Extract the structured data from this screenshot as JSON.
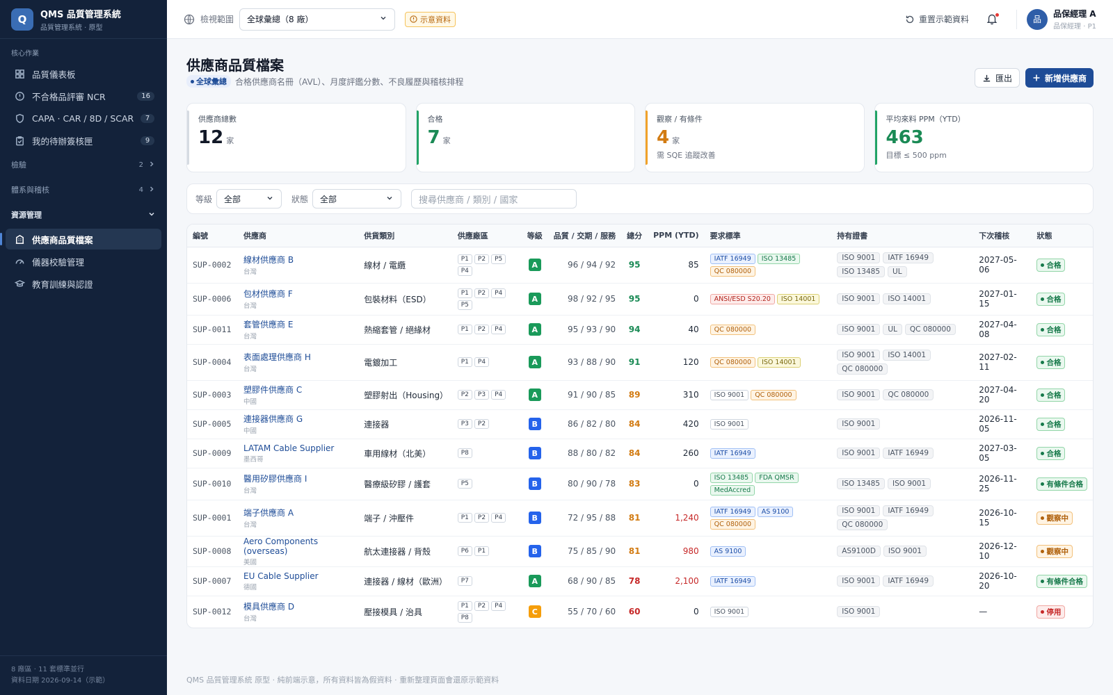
{
  "app": {
    "title": "QMS 品質管理系統",
    "subtitle": "品質管理系統 · 原型",
    "logo_letter": "Q"
  },
  "sidebar": {
    "core_section": "核心作業",
    "core_items": [
      {
        "label": "品質儀表板",
        "icon": "dashboard-icon",
        "badge": ""
      },
      {
        "label": "不合格品評審 NCR",
        "icon": "alert-circle-icon",
        "badge": "16"
      },
      {
        "label": "CAPA · CAR / 8D / SCAR",
        "icon": "shield-icon",
        "badge": "7"
      },
      {
        "label": "我的待辦簽核匣",
        "icon": "clipboard-icon",
        "badge": "9"
      }
    ],
    "groups": [
      {
        "label": "檢驗",
        "count": "2"
      },
      {
        "label": "體系與稽核",
        "count": "4"
      }
    ],
    "resource_section": "資源管理",
    "resource_items": [
      {
        "label": "供應商品質檔案",
        "icon": "building-icon",
        "active": true
      },
      {
        "label": "儀器校驗管理",
        "icon": "gauge-icon",
        "active": false
      },
      {
        "label": "教育訓練與認證",
        "icon": "graduation-cap-icon",
        "active": false
      }
    ],
    "footer_line1": "8 廠區 · 11 套標準並行",
    "footer_line2": "資料日期 2026-09-14（示範）"
  },
  "topbar": {
    "scope_label": "檢視範圍",
    "scope_value": "全球彙總（8 廠）",
    "demo_badge": "示意資料",
    "reset_label": "重置示範資料",
    "user_name": "品保經理 A",
    "user_role": "品保經理 · P1",
    "avatar_text": "品"
  },
  "page": {
    "title": "供應商品質檔案",
    "scope_chip": "全球彙總",
    "subtitle": "合格供應商名冊（AVL）、月度評鑑分數、不良履歷與稽核排程",
    "export_label": "匯出",
    "add_label": "新增供應商"
  },
  "kpis": [
    {
      "label": "供應商總數",
      "value": "12",
      "unit": "家",
      "note": ""
    },
    {
      "label": "合格",
      "value": "7",
      "unit": "家",
      "note": ""
    },
    {
      "label": "觀察 / 有條件",
      "value": "4",
      "unit": "家",
      "note": "需 SQE 追蹤改善"
    },
    {
      "label": "平均來料 PPM（YTD）",
      "value": "463",
      "unit": "",
      "note": "目標 ≤ 500 ppm"
    }
  ],
  "filters": {
    "grade_label": "等級",
    "grade_value": "全部",
    "status_label": "狀態",
    "status_value": "全部",
    "search_placeholder": "搜尋供應商 / 類別 / 國家"
  },
  "table": {
    "headers": [
      "編號",
      "供應商",
      "供貨類別",
      "供應廠區",
      "等級",
      "品質 / 交期 / 服務",
      "總分",
      "PPM (YTD)",
      "要求標準",
      "持有證書",
      "下次稽核",
      "狀態"
    ],
    "rows": [
      {
        "code": "SUP-0002",
        "name": "線材供應商 B",
        "country": "台灣",
        "category": "線材 / 電纜",
        "plants": [
          "P1",
          "P2",
          "P5",
          "P4"
        ],
        "grade": "A",
        "scores": "96 / 94 / 92",
        "total": "95",
        "total_level": "hi",
        "ppm": "85",
        "ppm_bad": false,
        "standards": [
          {
            "t": "IATF 16949",
            "c": "blue"
          },
          {
            "t": "ISO 13485",
            "c": "green"
          },
          {
            "t": "QC 080000",
            "c": "orange"
          }
        ],
        "certs": [
          "ISO 9001",
          "IATF 16949",
          "ISO 13485",
          "UL"
        ],
        "next_audit": "2027-05-06",
        "status": "合格",
        "status_type": "ok"
      },
      {
        "code": "SUP-0006",
        "name": "包材供應商 F",
        "country": "台灣",
        "category": "包裝材料（ESD）",
        "plants": [
          "P1",
          "P2",
          "P4",
          "P5"
        ],
        "grade": "A",
        "scores": "98 / 92 / 95",
        "total": "95",
        "total_level": "hi",
        "ppm": "0",
        "ppm_bad": false,
        "standards": [
          {
            "t": "ANSI/ESD S20.20",
            "c": "red"
          },
          {
            "t": "ISO 14001",
            "c": "yellow"
          }
        ],
        "certs": [
          "ISO 9001",
          "ISO 14001"
        ],
        "next_audit": "2027-01-15",
        "status": "合格",
        "status_type": "ok"
      },
      {
        "code": "SUP-0011",
        "name": "套管供應商 E",
        "country": "台灣",
        "category": "熱縮套管 / 絕緣材",
        "plants": [
          "P1",
          "P2",
          "P4"
        ],
        "grade": "A",
        "scores": "95 / 93 / 90",
        "total": "94",
        "total_level": "hi",
        "ppm": "40",
        "ppm_bad": false,
        "standards": [
          {
            "t": "QC 080000",
            "c": "orange"
          }
        ],
        "certs": [
          "ISO 9001",
          "UL",
          "QC 080000"
        ],
        "next_audit": "2027-04-08",
        "status": "合格",
        "status_type": "ok"
      },
      {
        "code": "SUP-0004",
        "name": "表面處理供應商 H",
        "country": "台灣",
        "category": "電鍍加工",
        "plants": [
          "P1",
          "P4"
        ],
        "grade": "A",
        "scores": "93 / 88 / 90",
        "total": "91",
        "total_level": "hi",
        "ppm": "120",
        "ppm_bad": false,
        "standards": [
          {
            "t": "QC 080000",
            "c": "orange"
          },
          {
            "t": "ISO 14001",
            "c": "yellow"
          }
        ],
        "certs": [
          "ISO 9001",
          "ISO 14001",
          "QC 080000"
        ],
        "next_audit": "2027-02-11",
        "status": "合格",
        "status_type": "ok"
      },
      {
        "code": "SUP-0003",
        "name": "塑膠件供應商 C",
        "country": "中國",
        "category": "塑膠射出（Housing）",
        "plants": [
          "P2",
          "P3",
          "P4"
        ],
        "grade": "A",
        "scores": "91 / 90 / 85",
        "total": "89",
        "total_level": "mid",
        "ppm": "310",
        "ppm_bad": false,
        "standards": [
          {
            "t": "ISO 9001",
            "c": "gray"
          },
          {
            "t": "QC 080000",
            "c": "orange"
          }
        ],
        "certs": [
          "ISO 9001",
          "QC 080000"
        ],
        "next_audit": "2027-04-20",
        "status": "合格",
        "status_type": "ok"
      },
      {
        "code": "SUP-0005",
        "name": "連接器供應商 G",
        "country": "中國",
        "category": "連接器",
        "plants": [
          "P3",
          "P2"
        ],
        "grade": "B",
        "scores": "86 / 82 / 80",
        "total": "84",
        "total_level": "mid",
        "ppm": "420",
        "ppm_bad": false,
        "standards": [
          {
            "t": "ISO 9001",
            "c": "gray"
          }
        ],
        "certs": [
          "ISO 9001"
        ],
        "next_audit": "2026-11-05",
        "status": "合格",
        "status_type": "ok"
      },
      {
        "code": "SUP-0009",
        "name": "LATAM Cable Supplier",
        "country": "墨西哥",
        "category": "車用線材（北美）",
        "plants": [
          "P8"
        ],
        "grade": "B",
        "scores": "88 / 80 / 82",
        "total": "84",
        "total_level": "mid",
        "ppm": "260",
        "ppm_bad": false,
        "standards": [
          {
            "t": "IATF 16949",
            "c": "blue"
          }
        ],
        "certs": [
          "ISO 9001",
          "IATF 16949"
        ],
        "next_audit": "2027-03-05",
        "status": "合格",
        "status_type": "ok"
      },
      {
        "code": "SUP-0010",
        "name": "醫用矽膠供應商 I",
        "country": "台灣",
        "category": "醫療級矽膠 / 護套",
        "plants": [
          "P5"
        ],
        "grade": "B",
        "scores": "80 / 90 / 78",
        "total": "83",
        "total_level": "mid",
        "ppm": "0",
        "ppm_bad": false,
        "standards": [
          {
            "t": "ISO 13485",
            "c": "green"
          },
          {
            "t": "FDA QMSR",
            "c": "green"
          },
          {
            "t": "MedAccred",
            "c": "green"
          }
        ],
        "certs": [
          "ISO 13485",
          "ISO 9001"
        ],
        "next_audit": "2026-11-25",
        "status": "有條件合格",
        "status_type": "cond"
      },
      {
        "code": "SUP-0001",
        "name": "端子供應商 A",
        "country": "台灣",
        "category": "端子 / 沖壓件",
        "plants": [
          "P1",
          "P2",
          "P4"
        ],
        "grade": "B",
        "scores": "72 / 95 / 88",
        "total": "81",
        "total_level": "mid",
        "ppm": "1,240",
        "ppm_bad": true,
        "standards": [
          {
            "t": "IATF 16949",
            "c": "blue"
          },
          {
            "t": "AS 9100",
            "c": "blue"
          },
          {
            "t": "QC 080000",
            "c": "orange"
          }
        ],
        "certs": [
          "ISO 9001",
          "IATF 16949",
          "QC 080000"
        ],
        "next_audit": "2026-10-15",
        "status": "觀察中",
        "status_type": "watch"
      },
      {
        "code": "SUP-0008",
        "name": "Aero Components (overseas)",
        "country": "美國",
        "category": "航太連接器 / 背殼",
        "plants": [
          "P6",
          "P1"
        ],
        "grade": "B",
        "scores": "75 / 85 / 90",
        "total": "81",
        "total_level": "mid",
        "ppm": "980",
        "ppm_bad": true,
        "standards": [
          {
            "t": "AS 9100",
            "c": "blue"
          }
        ],
        "certs": [
          "AS9100D",
          "ISO 9001"
        ],
        "next_audit": "2026-12-10",
        "status": "觀察中",
        "status_type": "watch"
      },
      {
        "code": "SUP-0007",
        "name": "EU Cable Supplier",
        "country": "德國",
        "category": "連接器 / 線材（歐洲）",
        "plants": [
          "P7"
        ],
        "grade": "A",
        "scores": "68 / 90 / 85",
        "total": "78",
        "total_level": "lo",
        "ppm": "2,100",
        "ppm_bad": true,
        "standards": [
          {
            "t": "IATF 16949",
            "c": "blue"
          }
        ],
        "certs": [
          "ISO 9001",
          "IATF 16949"
        ],
        "next_audit": "2026-10-20",
        "status": "有條件合格",
        "status_type": "cond"
      },
      {
        "code": "SUP-0012",
        "name": "模具供應商 D",
        "country": "台灣",
        "category": "壓接模具 / 治具",
        "plants": [
          "P1",
          "P2",
          "P4",
          "P8"
        ],
        "grade": "C",
        "scores": "55 / 70 / 60",
        "total": "60",
        "total_level": "lo",
        "ppm": "0",
        "ppm_bad": false,
        "standards": [
          {
            "t": "ISO 9001",
            "c": "gray"
          }
        ],
        "certs": [
          "ISO 9001"
        ],
        "next_audit": "—",
        "status": "停用",
        "status_type": "stop"
      }
    ]
  },
  "footer_note": "QMS 品質管理系統 原型 · 純前端示意，所有資料皆為假資料 · 重新整理頁面會還原示範資料"
}
